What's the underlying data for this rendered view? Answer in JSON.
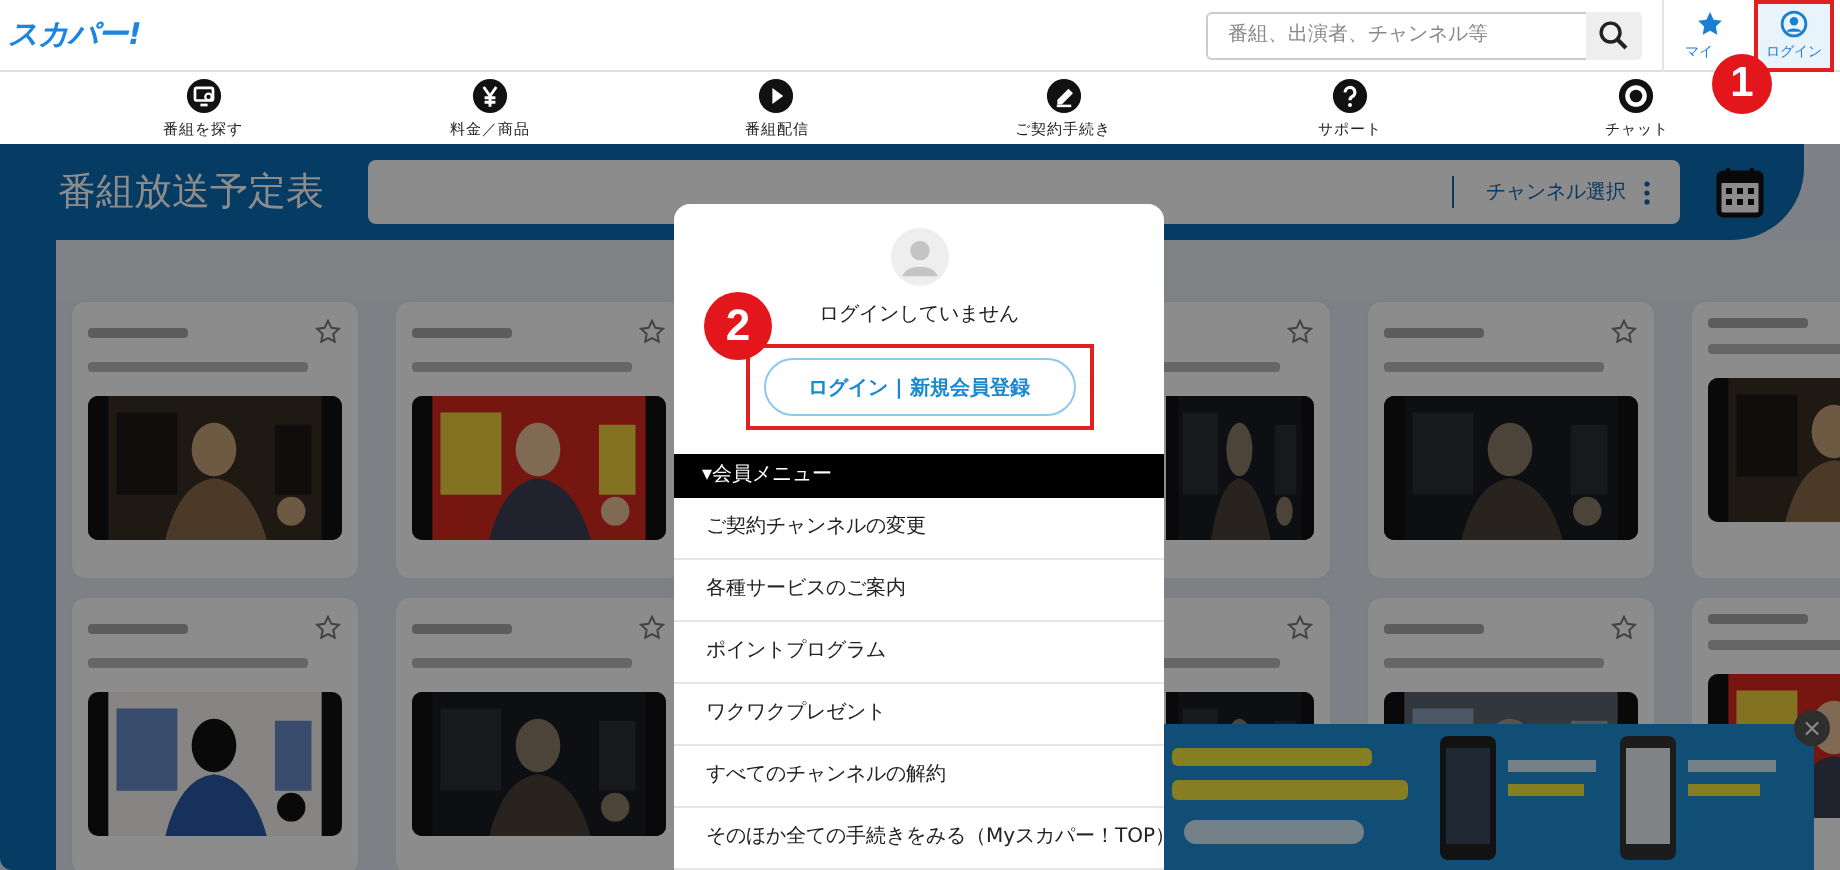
{
  "header": {
    "logo": "スカパー!",
    "search": {
      "placeholder": "番組、出演者、チャンネル等"
    },
    "mylist": {
      "label": "マイ"
    },
    "login": {
      "label": "ログイン"
    }
  },
  "nav": [
    {
      "kind": "search",
      "label": "番組を探す"
    },
    {
      "kind": "price",
      "label": "料金／商品"
    },
    {
      "kind": "play",
      "label": "番組配信"
    },
    {
      "kind": "edit",
      "label": "ご契約手続き"
    },
    {
      "kind": "help",
      "label": "サポート"
    },
    {
      "kind": "chat",
      "label": "チャット"
    }
  ],
  "schedule": {
    "title": "番組放送予定表",
    "channel_select": "チャンネル選択"
  },
  "ad": {
    "kind": "picture",
    "close": "×"
  },
  "member_panel": {
    "status": "ログインしていません",
    "login_button": "ログイン | 新規会員登録",
    "menu_title": "▾会員メニュー",
    "items": [
      {
        "label": "ご契約チャンネルの変更"
      },
      {
        "label": "各種サービスのご案内"
      },
      {
        "label": "ポイントプログラム"
      },
      {
        "label": "ワクワクプレゼント"
      },
      {
        "label": "すべてのチャンネルの解約"
      },
      {
        "label": "そのほか全ての手続きをみる（Myスカパー！TOP）"
      }
    ]
  },
  "callouts": [
    {
      "number": "1"
    },
    {
      "number": "2"
    }
  ]
}
